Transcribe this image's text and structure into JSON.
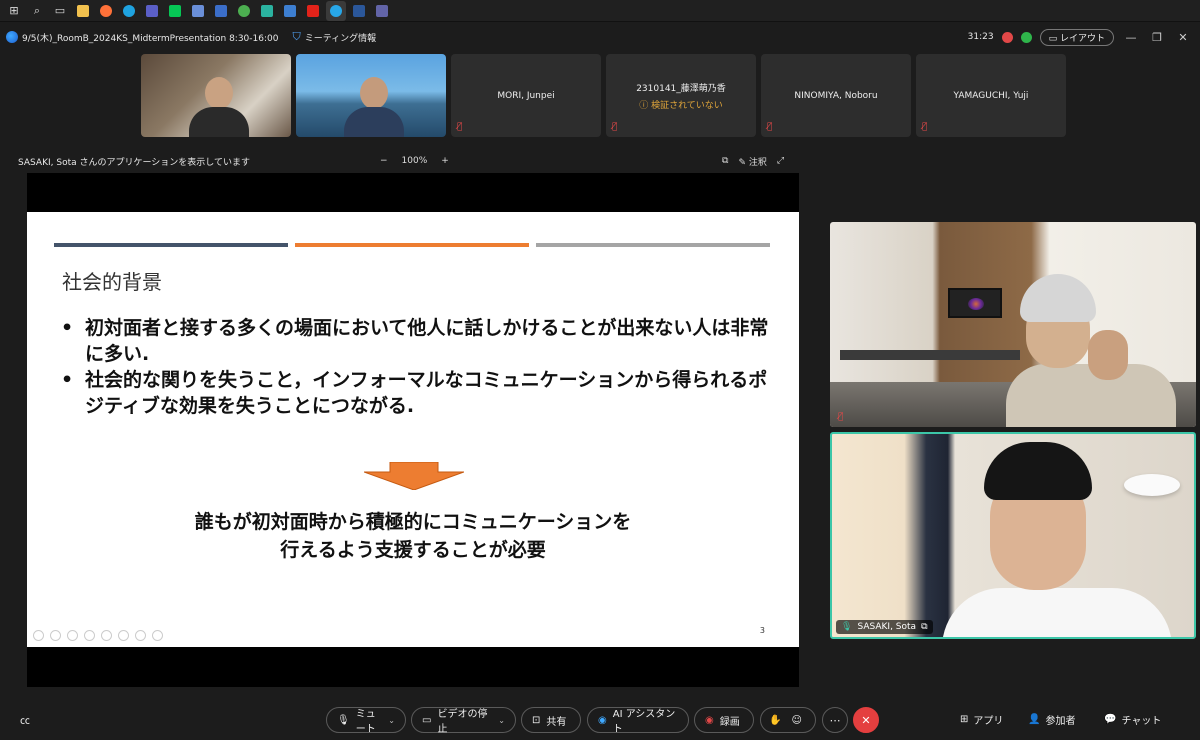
{
  "taskbar": {
    "icons": [
      "windows-icon",
      "search-icon",
      "task-view-icon",
      "file-explorer-icon",
      "firefox-icon",
      "edge-icon",
      "teams-icon",
      "line-icon",
      "snipping-icon",
      "app-icon",
      "chrome-icon",
      "app-icon-2",
      "app-icon-3",
      "acrobat-icon",
      "webex-icon",
      "word-icon",
      "teams-icon-2"
    ]
  },
  "titlebar": {
    "meeting_title": "9/5(木)_RoomB_2024KS_MidtermPresentation 8:30-16:00",
    "meeting_info": "ミーティング情報",
    "timer": "31:23",
    "layout_label": "レイアウト"
  },
  "participants": [
    {
      "name": "",
      "has_video": true
    },
    {
      "name": "",
      "has_video": true
    },
    {
      "name": "MORI, Junpei",
      "has_video": false
    },
    {
      "name": "2310141_藤澤萌乃香",
      "status": "検証されていない",
      "has_video": false
    },
    {
      "name": "NINOMIYA, Noboru",
      "has_video": false
    },
    {
      "name": "YAMAGUCHI, Yuji",
      "has_video": false
    }
  ],
  "sharebar": {
    "label": "SASAKI, Sota さんのアプリケーションを表示しています",
    "zoom_minus": "−",
    "zoom_level": "100%",
    "zoom_plus": "+",
    "annotate_label": "注釈"
  },
  "slide": {
    "title": "社会的背景",
    "bullets": [
      "初対面者と接する多くの場面において他人に話しかけることが出来ない人は非常に多い.",
      "社会的な関りを失うこと，インフォーマルなコミュニケーションから得られるポジティブな効果を失うことにつながる."
    ],
    "conclusion_line1": "誰もが初対面時から積極的にコミュニケーションを",
    "conclusion_line2": "行えるよう支援することが必要",
    "page_number": "3",
    "colors": {
      "bar1": "#44546a",
      "bar2": "#ed7d31",
      "bar3": "#a5a5a5",
      "arrow": "#ed7d31"
    }
  },
  "videos": {
    "bottom_name": "SASAKI, Sota"
  },
  "controls": {
    "mute": "ミュート",
    "stop_video": "ビデオの停止",
    "share": "共有",
    "ai_assistant": "AI アシスタント",
    "record": "録画",
    "apps": "アプリ",
    "participants": "参加者",
    "chat": "チャット"
  }
}
